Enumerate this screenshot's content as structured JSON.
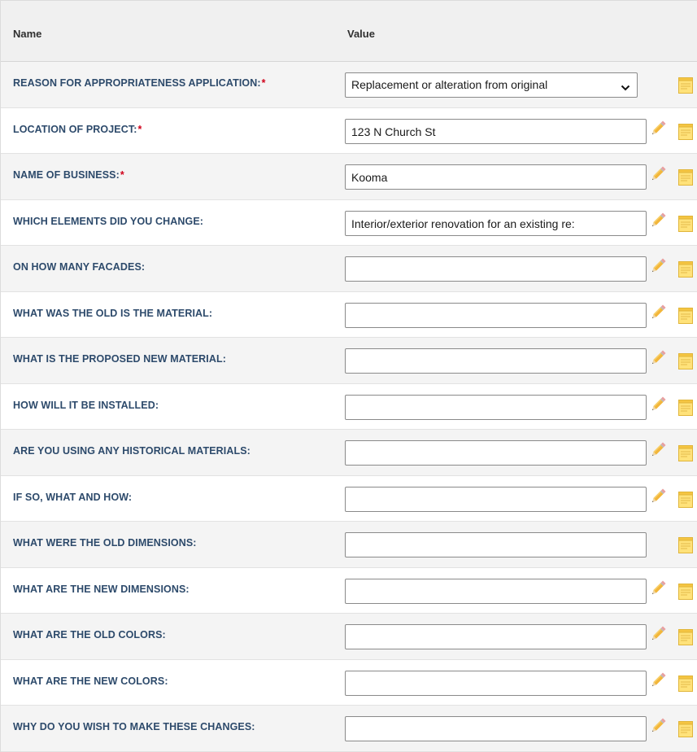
{
  "header": {
    "name_label": "Name",
    "value_label": "Value"
  },
  "rows": [
    {
      "label": "REASON FOR APPROPRIATENESS APPLICATION:",
      "required": "*",
      "value": "Replacement or alteration from original",
      "type": "select",
      "pencil": false
    },
    {
      "label": "LOCATION OF PROJECT:",
      "required": "*",
      "value": "123 N Church St",
      "type": "text",
      "pencil": true
    },
    {
      "label": "NAME OF BUSINESS:",
      "required": "*",
      "value": "Kooma",
      "type": "text",
      "pencil": true
    },
    {
      "label": "WHICH ELEMENTS DID YOU CHANGE:",
      "required": "",
      "value": "Interior/exterior renovation for an existing re:",
      "type": "text",
      "pencil": true
    },
    {
      "label": "ON HOW MANY FACADES:",
      "required": "",
      "value": "",
      "type": "text",
      "pencil": true
    },
    {
      "label": "WHAT WAS THE OLD IS THE MATERIAL:",
      "required": "",
      "value": "",
      "type": "text",
      "pencil": true
    },
    {
      "label": "WHAT IS THE PROPOSED NEW MATERIAL:",
      "required": "",
      "value": "",
      "type": "text",
      "pencil": true
    },
    {
      "label": "HOW WILL IT BE INSTALLED:",
      "required": "",
      "value": "",
      "type": "text",
      "pencil": true
    },
    {
      "label": "ARE YOU USING ANY HISTORICAL MATERIALS:",
      "required": "",
      "value": "",
      "type": "text",
      "pencil": true
    },
    {
      "label": "IF SO, WHAT AND HOW:",
      "required": "",
      "value": "",
      "type": "text",
      "pencil": true
    },
    {
      "label": "WHAT WERE THE OLD DIMENSIONS:",
      "required": "",
      "value": "",
      "type": "text",
      "pencil": false
    },
    {
      "label": "WHAT ARE THE NEW DIMENSIONS:",
      "required": "",
      "value": "",
      "type": "text",
      "pencil": true
    },
    {
      "label": "WHAT ARE THE OLD COLORS:",
      "required": "",
      "value": "",
      "type": "text",
      "pencil": true
    },
    {
      "label": "WHAT ARE THE NEW COLORS:",
      "required": "",
      "value": "",
      "type": "text",
      "pencil": true
    },
    {
      "label": "WHY DO YOU WISH TO MAKE THESE CHANGES:",
      "required": "",
      "value": "",
      "type": "text",
      "pencil": true
    }
  ],
  "icons": {
    "edit": "pencil-icon",
    "note": "sticky-note-icon",
    "dropdown": "chevron-down-icon"
  },
  "colors": {
    "label": "#2d4a6b",
    "required": "#d0021b",
    "header_bg": "#f0f0f0",
    "alt_row_bg": "#f4f4f4"
  }
}
